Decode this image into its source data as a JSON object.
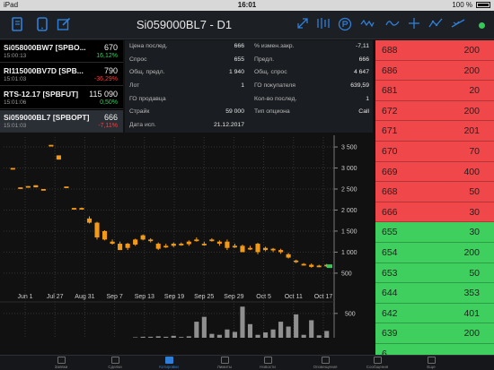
{
  "status_bar": {
    "device": "iPad",
    "time": "16:01",
    "battery": "100 %"
  },
  "toolbar": {
    "title": "Si059000BL7 - D1",
    "icons": [
      "book-icon",
      "tablet-icon",
      "edit-icon",
      "expand-icon",
      "indicators-icon",
      "rouble-icon",
      "wave-icon",
      "crosshair-icon",
      "zigzag-icon",
      "trendline-icon",
      "status-dot-icon"
    ]
  },
  "watchlist": [
    {
      "name": "Si058000BW7 [SPBO...",
      "time": "15:00:13",
      "price": "670",
      "change": "16,12%",
      "change_color": "#2fd05a",
      "selected": false
    },
    {
      "name": "RI115000BV7D [SPB...",
      "time": "15:01:03",
      "price": "790",
      "change": "-36,29%",
      "change_color": "#ff3b3b",
      "selected": false
    },
    {
      "name": "RTS-12.17 [SPBFUT]",
      "time": "15:01:06",
      "price": "115 090",
      "change": "0,50%",
      "change_color": "#2fd05a",
      "selected": false
    },
    {
      "name": "Si059000BL7 [SPBOPT]",
      "time": "15:01:03",
      "price": "666",
      "change": "-7,11%",
      "change_color": "#ff3b3b",
      "selected": true
    }
  ],
  "info": {
    "left": [
      {
        "label": "Цена послед.",
        "value": "666"
      },
      {
        "label": "Спрос",
        "value": "655"
      },
      {
        "label": "Общ. предл.",
        "value": "1 940"
      },
      {
        "label": "Лот",
        "value": "1"
      },
      {
        "label": "ГО продавца",
        "value": ""
      },
      {
        "label": "Страйк",
        "value": "59 000"
      },
      {
        "label": "Дата исп.",
        "value": "21.12.2017"
      }
    ],
    "right": [
      {
        "label": "% измен.закр.",
        "value": "-7,11"
      },
      {
        "label": "Предл.",
        "value": "666"
      },
      {
        "label": "Общ. спрос",
        "value": "4 647"
      },
      {
        "label": "ГО покупателя",
        "value": "639,59"
      },
      {
        "label": "Кол-во послед.",
        "value": "1"
      },
      {
        "label": "Тип опциона",
        "value": "Call"
      },
      {
        "label": "",
        "value": ""
      }
    ]
  },
  "chart_data": {
    "type": "candlestick",
    "y_ticks": [
      "3 500",
      "3 000",
      "2 500",
      "2 000",
      "1 500",
      "1 000",
      "500"
    ],
    "y_tick_values": [
      3500,
      3000,
      2500,
      2000,
      1500,
      1000,
      500
    ],
    "ylim": [
      200,
      3650
    ],
    "x_ticks": [
      "Jun 1",
      "Jul 27",
      "Aug 31",
      "Sep 7",
      "Sep 13",
      "Sep 19",
      "Sep 25",
      "Sep 29",
      "Oct 5",
      "Oct 11",
      "Oct 17"
    ],
    "volume_ticks": [
      "500"
    ],
    "candles": [
      {
        "open": 3000,
        "close": 3000,
        "high": 3000,
        "low": 3000
      },
      {
        "open": 2540,
        "close": 2540,
        "high": 2540,
        "low": 2540
      },
      {
        "open": 2560,
        "close": 2570,
        "high": 2570,
        "low": 2540
      },
      {
        "open": 2590,
        "close": 2540,
        "high": 2590,
        "low": 2540
      },
      {
        "open": 2500,
        "close": 2500,
        "high": 2500,
        "low": 2500
      },
      {
        "open": 3550,
        "close": 3550,
        "high": 3550,
        "low": 3550
      },
      {
        "open": 3300,
        "close": 3200,
        "high": 3300,
        "low": 3200
      },
      {
        "open": 2560,
        "close": 2560,
        "high": 2560,
        "low": 2560
      },
      {
        "open": 2050,
        "close": 2030,
        "high": 2050,
        "low": 2020
      },
      {
        "open": 2050,
        "close": 2040,
        "high": 2060,
        "low": 2030
      },
      {
        "open": 1800,
        "close": 1700,
        "high": 1850,
        "low": 1680
      },
      {
        "open": 1700,
        "close": 1350,
        "high": 1720,
        "low": 1300
      },
      {
        "open": 1500,
        "close": 1300,
        "high": 1520,
        "low": 1280
      },
      {
        "open": 1250,
        "close": 1200,
        "high": 1300,
        "low": 1180
      },
      {
        "open": 1050,
        "close": 1200,
        "high": 1250,
        "low": 1050
      },
      {
        "open": 1200,
        "close": 1100,
        "high": 1220,
        "low": 1050
      },
      {
        "open": 1300,
        "close": 1180,
        "high": 1320,
        "low": 1150
      },
      {
        "open": 1400,
        "close": 1300,
        "high": 1420,
        "low": 1280
      },
      {
        "open": 1280,
        "close": 1300,
        "high": 1330,
        "low": 1230
      },
      {
        "open": 1200,
        "close": 1080,
        "high": 1230,
        "low": 1050
      },
      {
        "open": 1150,
        "close": 1150,
        "high": 1200,
        "low": 1100
      },
      {
        "open": 1200,
        "close": 1150,
        "high": 1230,
        "low": 1120
      },
      {
        "open": 1180,
        "close": 1200,
        "high": 1230,
        "low": 1150
      },
      {
        "open": 1250,
        "close": 1190,
        "high": 1280,
        "low": 1150
      },
      {
        "open": 1300,
        "close": 1300,
        "high": 1350,
        "low": 1250
      },
      {
        "open": 1200,
        "close": 1200,
        "high": 1250,
        "low": 1150
      },
      {
        "open": 1300,
        "close": 1300,
        "high": 1330,
        "low": 1250
      },
      {
        "open": 1250,
        "close": 1200,
        "high": 1280,
        "low": 1150
      },
      {
        "open": 1250,
        "close": 1100,
        "high": 1300,
        "low": 1050
      },
      {
        "open": 1150,
        "close": 1150,
        "high": 1200,
        "low": 1100
      },
      {
        "open": 1000,
        "close": 1150,
        "high": 1180,
        "low": 1000
      },
      {
        "open": 1100,
        "close": 1100,
        "high": 1150,
        "low": 1050
      },
      {
        "open": 1200,
        "close": 1000,
        "high": 1220,
        "low": 950
      },
      {
        "open": 1050,
        "close": 1100,
        "high": 1130,
        "low": 1020
      },
      {
        "open": 1080,
        "close": 1050,
        "high": 1100,
        "low": 1000
      },
      {
        "open": 1050,
        "close": 1000,
        "high": 1080,
        "low": 960
      },
      {
        "open": 950,
        "close": 870,
        "high": 980,
        "low": 850
      },
      {
        "open": 800,
        "close": 770,
        "high": 820,
        "low": 740
      },
      {
        "open": 720,
        "close": 700,
        "high": 740,
        "low": 680
      },
      {
        "open": 700,
        "close": 650,
        "high": 730,
        "low": 630
      },
      {
        "open": 680,
        "close": 680,
        "high": 700,
        "low": 640
      },
      {
        "open": 700,
        "close": 666,
        "high": 720,
        "low": 640
      }
    ],
    "volumes": [
      0,
      0,
      0,
      0,
      0,
      0,
      0,
      0,
      0,
      0,
      0,
      0,
      0,
      0,
      0,
      0,
      10,
      20,
      20,
      30,
      20,
      40,
      15,
      30,
      330,
      430,
      80,
      60,
      170,
      120,
      640,
      280,
      60,
      110,
      170,
      330,
      230,
      480,
      60,
      360,
      50,
      140
    ]
  },
  "order_book": [
    {
      "price": "688",
      "qty": "200",
      "side": "ask"
    },
    {
      "price": "686",
      "qty": "200",
      "side": "ask"
    },
    {
      "price": "681",
      "qty": "20",
      "side": "ask"
    },
    {
      "price": "672",
      "qty": "200",
      "side": "ask"
    },
    {
      "price": "671",
      "qty": "201",
      "side": "ask"
    },
    {
      "price": "670",
      "qty": "70",
      "side": "ask"
    },
    {
      "price": "669",
      "qty": "400",
      "side": "ask"
    },
    {
      "price": "668",
      "qty": "50",
      "side": "ask"
    },
    {
      "price": "666",
      "qty": "30",
      "side": "ask"
    },
    {
      "price": "655",
      "qty": "30",
      "side": "bid"
    },
    {
      "price": "654",
      "qty": "200",
      "side": "bid"
    },
    {
      "price": "653",
      "qty": "50",
      "side": "bid"
    },
    {
      "price": "644",
      "qty": "353",
      "side": "bid"
    },
    {
      "price": "642",
      "qty": "401",
      "side": "bid"
    },
    {
      "price": "639",
      "qty": "200",
      "side": "bid"
    },
    {
      "price": "6",
      "qty": "",
      "side": "bid"
    }
  ],
  "colors": {
    "ask": "#f0474a",
    "bid": "#3fcf5f",
    "candle_up": "#f29a17",
    "candle_down": "#f29a17",
    "volume": "#8f8f8f",
    "accent": "#2f7fd8"
  },
  "tabs": [
    {
      "label": "Заявки",
      "icon": "orders-icon",
      "active": false
    },
    {
      "label": "Сделки",
      "icon": "trades-icon",
      "active": false
    },
    {
      "label": "Котировки",
      "icon": "quotes-icon",
      "active": true
    },
    {
      "label": "Лимиты",
      "icon": "limits-icon",
      "active": false
    },
    {
      "label": "Новости",
      "icon": "news-icon",
      "active": false
    },
    {
      "label": "Оповещения",
      "icon": "alerts-icon",
      "active": false
    },
    {
      "label": "Сообщения",
      "icon": "messages-icon",
      "active": false
    },
    {
      "label": "Еще",
      "icon": "more-icon",
      "active": false
    }
  ]
}
